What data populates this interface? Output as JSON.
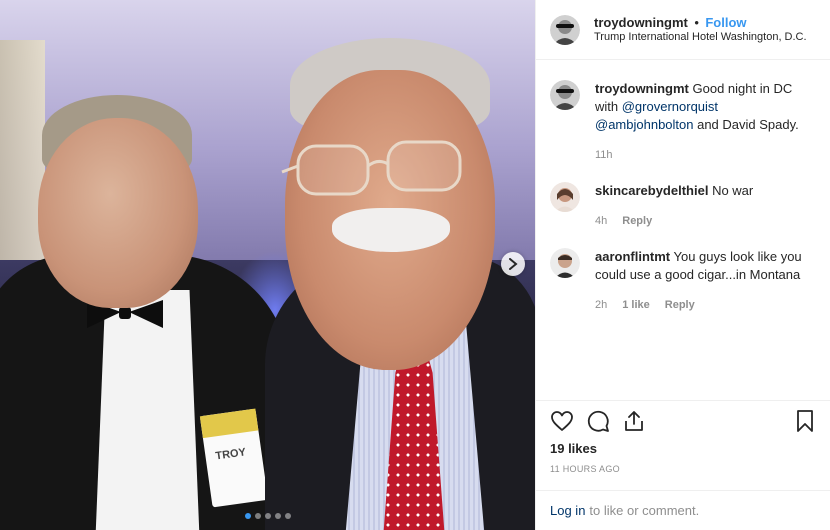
{
  "post": {
    "username": "troydowningmt",
    "bullet": "•",
    "follow_label": "Follow",
    "location": "Trump International Hotel Washington, D.C."
  },
  "caption": {
    "username": "troydowningmt",
    "text_1": " Good night in DC with ",
    "mention_1": "@grovernorquist",
    "text_2": " ",
    "mention_2": "@ambjohnbolton",
    "text_3": " and David Spady.",
    "time": "11h"
  },
  "comments": [
    {
      "username": "skincarebydelthiel",
      "text": " No war",
      "time": "4h",
      "likes": "",
      "reply_label": "Reply"
    },
    {
      "username": "aaronflintmt",
      "text": " You guys look like you could use a good cigar...in Montana",
      "time": "2h",
      "likes": "1 like",
      "reply_label": "Reply"
    }
  ],
  "stats": {
    "likes": "19 likes",
    "posted": "11 HOURS AGO"
  },
  "login": {
    "link": "Log in",
    "rest": "to like or comment."
  },
  "carousel": {
    "total": 5,
    "active": 0
  },
  "colors": {
    "accent": "#3897f0",
    "mention": "#003569",
    "muted": "#8e8e8e"
  },
  "icons": [
    "heart-icon",
    "comment-icon",
    "share-icon",
    "bookmark-icon",
    "chevron-right-icon"
  ]
}
